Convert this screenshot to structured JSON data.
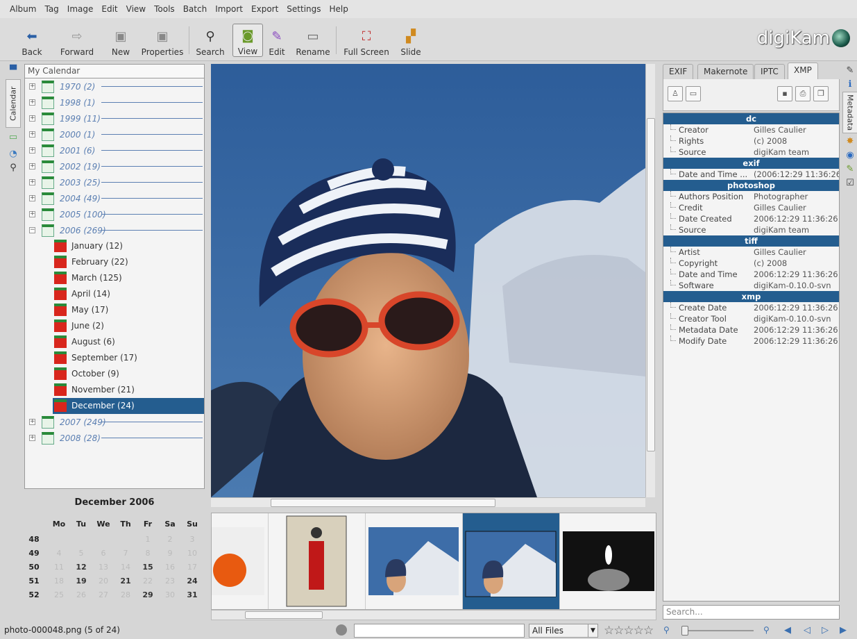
{
  "menu": [
    "Album",
    "Tag",
    "Image",
    "Edit",
    "View",
    "Tools",
    "Batch",
    "Import",
    "Export",
    "Settings",
    "Help"
  ],
  "toolbar": {
    "back": "Back",
    "forward": "Forward",
    "new": "New",
    "properties": "Properties",
    "search": "Search",
    "view": "View",
    "edit": "Edit",
    "rename": "Rename",
    "fullscreen": "Full Screen",
    "slide": "Slide"
  },
  "logo": "digiKam",
  "left_tabs": {
    "calendar": "Calendar"
  },
  "tree": {
    "header": "My Calendar",
    "years": [
      {
        "label": "1970 (2)"
      },
      {
        "label": "1998 (1)"
      },
      {
        "label": "1999 (11)"
      },
      {
        "label": "2000 (1)"
      },
      {
        "label": "2001 (6)"
      },
      {
        "label": "2002 (19)"
      },
      {
        "label": "2003 (25)"
      },
      {
        "label": "2004 (49)"
      },
      {
        "label": "2005 (100)"
      },
      {
        "label": "2006 (269)"
      }
    ],
    "months": [
      {
        "label": "January (12)"
      },
      {
        "label": "February (22)"
      },
      {
        "label": "March (125)"
      },
      {
        "label": "April (14)"
      },
      {
        "label": "May (17)"
      },
      {
        "label": "June (2)"
      },
      {
        "label": "August (6)"
      },
      {
        "label": "September (17)"
      },
      {
        "label": "October (9)"
      },
      {
        "label": "November (21)"
      },
      {
        "label": "December (24)"
      }
    ],
    "years_after": [
      {
        "label": "2007 (249)"
      },
      {
        "label": "2008 (28)"
      }
    ]
  },
  "minical": {
    "title": "December 2006",
    "days": [
      "Mo",
      "Tu",
      "We",
      "Th",
      "Fr",
      "Sa",
      "Su"
    ],
    "weeks": [
      {
        "wk": "48",
        "d": [
          "",
          "",
          "",
          "",
          "1",
          "2",
          "3"
        ]
      },
      {
        "wk": "49",
        "d": [
          "4",
          "5",
          "6",
          "7",
          "8",
          "9",
          "10"
        ]
      },
      {
        "wk": "50",
        "d": [
          "11",
          "12",
          "13",
          "14",
          "15",
          "16",
          "17"
        ]
      },
      {
        "wk": "51",
        "d": [
          "18",
          "19",
          "20",
          "21",
          "22",
          "23",
          "24"
        ]
      },
      {
        "wk": "52",
        "d": [
          "25",
          "26",
          "27",
          "28",
          "29",
          "30",
          "31"
        ]
      }
    ],
    "bold_days": [
      "12",
      "15",
      "19",
      "21",
      "24",
      "29",
      "31"
    ]
  },
  "right_tabs": [
    "EXIF",
    "Makernote",
    "IPTC",
    "XMP"
  ],
  "right_rail": {
    "metadata": "Metadata"
  },
  "metadata": [
    {
      "group": "dc",
      "rows": [
        [
          "Creator",
          "Gilles Caulier"
        ],
        [
          "Rights",
          "(c) 2008"
        ],
        [
          "Source",
          "digiKam team"
        ]
      ]
    },
    {
      "group": "exif",
      "rows": [
        [
          "Date and Time ...",
          "(2006:12:29 11:36:26)"
        ]
      ]
    },
    {
      "group": "photoshop",
      "rows": [
        [
          "Authors Position",
          "Photographer"
        ],
        [
          "Credit",
          "Gilles Caulier"
        ],
        [
          "Date Created",
          "2006:12:29 11:36:26"
        ],
        [
          "Source",
          "digiKam team"
        ]
      ]
    },
    {
      "group": "tiff",
      "rows": [
        [
          "Artist",
          "Gilles Caulier"
        ],
        [
          "Copyright",
          "(c) 2008"
        ],
        [
          "Date and Time",
          "2006:12:29 11:36:26"
        ],
        [
          "Software",
          "digiKam-0.10.0-svn"
        ]
      ]
    },
    {
      "group": "xmp",
      "rows": [
        [
          "Create Date",
          "2006:12:29 11:36:26"
        ],
        [
          "Creator Tool",
          "digiKam-0.10.0-svn"
        ],
        [
          "Metadata Date",
          "2006:12:29 11:36:26"
        ],
        [
          "Modify Date",
          "2006:12:29 11:36:26"
        ]
      ]
    }
  ],
  "search_placeholder": "Search...",
  "status": {
    "text": "photo-000048.png (5 of 24)",
    "filetype": "All Files",
    "stars": "☆☆☆☆☆"
  },
  "colors": {
    "selection": "#245d8f",
    "tree_link": "#5b7fb2"
  }
}
